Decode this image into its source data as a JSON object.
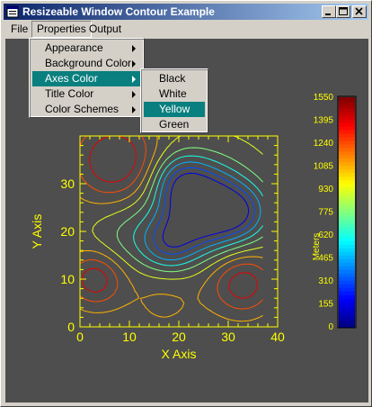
{
  "window": {
    "title": "Resizeable Window Contour Example"
  },
  "menubar": {
    "items": [
      {
        "label": "File"
      },
      {
        "label": "Properties"
      },
      {
        "label": "Output"
      }
    ]
  },
  "properties_menu": {
    "items": [
      {
        "label": "Appearance",
        "has_submenu": true
      },
      {
        "label": "Background Color",
        "has_submenu": true
      },
      {
        "label": "Axes Color",
        "has_submenu": true,
        "highlighted": true
      },
      {
        "label": "Title Color",
        "has_submenu": true
      },
      {
        "label": "Color Schemes",
        "has_submenu": true
      }
    ]
  },
  "axes_color_submenu": {
    "items": [
      {
        "label": "Black"
      },
      {
        "label": "White"
      },
      {
        "label": "Yellow",
        "highlighted": true
      },
      {
        "label": "Green"
      }
    ]
  },
  "colors": {
    "titlebar_start": "#0a246a",
    "titlebar_end": "#a6caf0",
    "menu_highlight": "#0a7f7f",
    "plot_background": "#4e4e4e",
    "axes": "#ffff00"
  },
  "chart_data": {
    "type": "contour",
    "xlabel": "X Axis",
    "ylabel": "Y Axis",
    "xlim": [
      0,
      40
    ],
    "ylim": [
      0,
      40
    ],
    "xticks": [
      "0",
      "10",
      "20",
      "30",
      "40"
    ],
    "yticks": [
      "0",
      "10",
      "20",
      "30"
    ],
    "colorbar": {
      "label": "Meters",
      "min": 0,
      "max": 1550,
      "ticks": [
        "0",
        "155",
        "310",
        "465",
        "620",
        "775",
        "930",
        "1085",
        "1240",
        "1395",
        "1550"
      ],
      "colormap": "jet"
    }
  }
}
